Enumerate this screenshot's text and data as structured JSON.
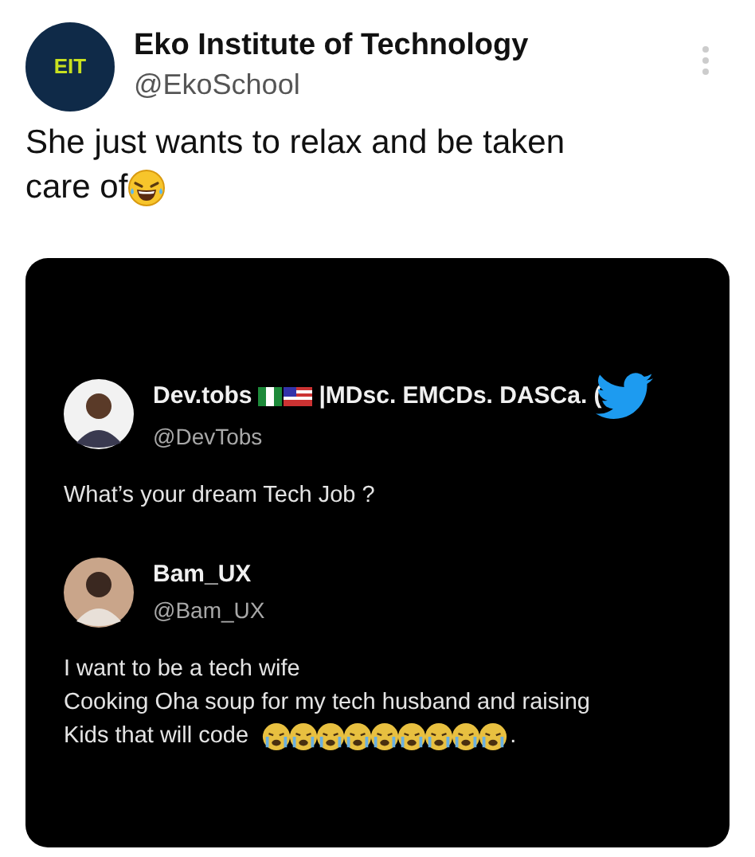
{
  "tweet": {
    "author": {
      "name": "Eko Institute of Technology",
      "handle": "@EkoSchool",
      "logo_text": "EIT"
    },
    "text_lines": [
      "She just wants to relax and be taken",
      "care of"
    ],
    "image": {
      "posts": [
        {
          "kind": "question",
          "name": "Dev.tobs",
          "name_suffix": "|MDsc. EMCDs. DASCa. (",
          "handle": "@DevTobs",
          "lines": [
            "What’s your dream Tech Job ?"
          ]
        },
        {
          "kind": "answer",
          "name": "Bam_UX",
          "handle": "@Bam_UX",
          "lines": [
            "I want to be a tech wife",
            "Cooking Oha soup for my tech husband and raising",
            "Kids that will code"
          ],
          "trailing": "."
        }
      ]
    }
  }
}
